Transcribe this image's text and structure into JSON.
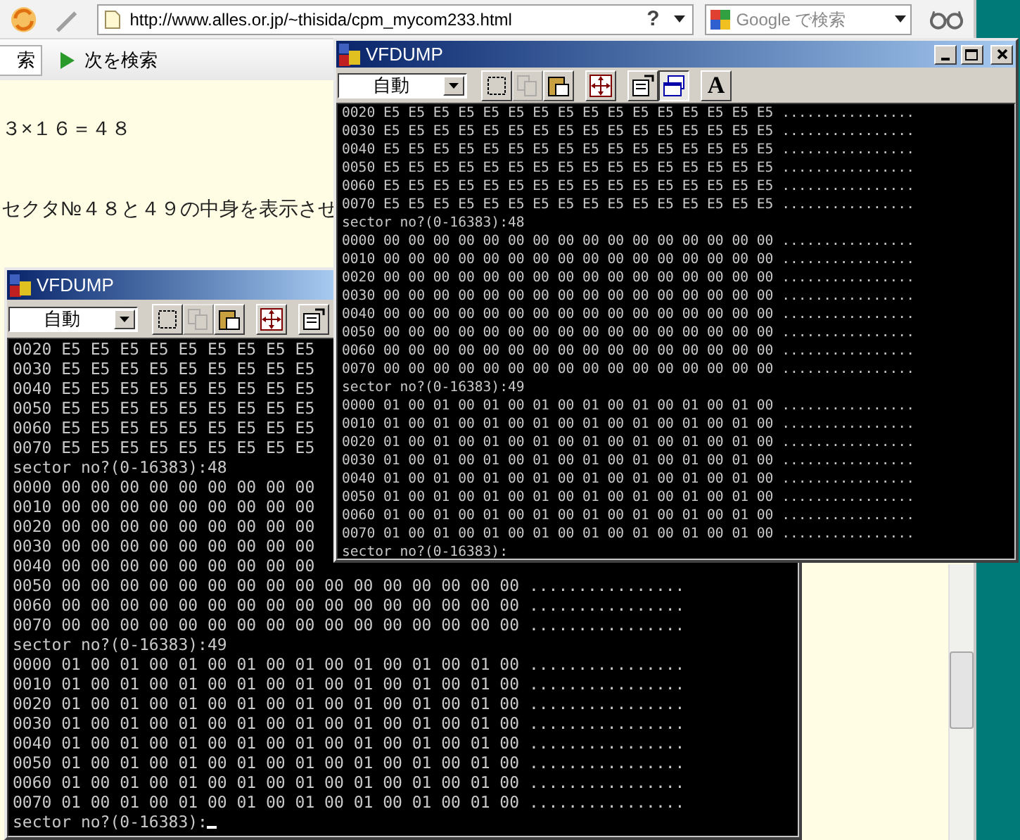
{
  "browser": {
    "address": "http://www.alles.or.jp/~thisida/cpm_mycom233.html",
    "help_button": "?",
    "search": {
      "placeholder": "Google で検索"
    },
    "find_bar": {
      "field_value": "索",
      "next_button": "次を検索"
    }
  },
  "page": {
    "lines": [
      "３×１６＝４８",
      "セクタ№４８と４９の中身を表示させ"
    ]
  },
  "windows": [
    {
      "title": "VFDUMP",
      "mode": "自動",
      "cursor": true,
      "tools": [
        {
          "kind": "select",
          "disabled": false,
          "pressed": false
        },
        {
          "kind": "copy",
          "disabled": true,
          "pressed": false
        },
        {
          "kind": "paste",
          "disabled": false,
          "pressed": false
        },
        {
          "kind": "fullscreen",
          "disabled": false,
          "pressed": false
        },
        {
          "kind": "properties",
          "disabled": false,
          "pressed": false
        }
      ],
      "lines": [
        "0020 E5 E5 E5 E5 E5 E5 E5 E5 E5",
        "0030 E5 E5 E5 E5 E5 E5 E5 E5 E5",
        "0040 E5 E5 E5 E5 E5 E5 E5 E5 E5",
        "0050 E5 E5 E5 E5 E5 E5 E5 E5 E5",
        "0060 E5 E5 E5 E5 E5 E5 E5 E5 E5",
        "0070 E5 E5 E5 E5 E5 E5 E5 E5 E5",
        "sector no?(0-16383):48",
        "0000 00 00 00 00 00 00 00 00 00",
        "0010 00 00 00 00 00 00 00 00 00",
        "0020 00 00 00 00 00 00 00 00 00",
        "0030 00 00 00 00 00 00 00 00 00",
        "0040 00 00 00 00 00 00 00 00 00",
        "0050 00 00 00 00 00 00 00 00 00 00 00 00 00 00 00 00 ................",
        "0060 00 00 00 00 00 00 00 00 00 00 00 00 00 00 00 00 ................",
        "0070 00 00 00 00 00 00 00 00 00 00 00 00 00 00 00 00 ................",
        "sector no?(0-16383):49",
        "0000 01 00 01 00 01 00 01 00 01 00 01 00 01 00 01 00 ................",
        "0010 01 00 01 00 01 00 01 00 01 00 01 00 01 00 01 00 ................",
        "0020 01 00 01 00 01 00 01 00 01 00 01 00 01 00 01 00 ................",
        "0030 01 00 01 00 01 00 01 00 01 00 01 00 01 00 01 00 ................",
        "0040 01 00 01 00 01 00 01 00 01 00 01 00 01 00 01 00 ................",
        "0050 01 00 01 00 01 00 01 00 01 00 01 00 01 00 01 00 ................",
        "0060 01 00 01 00 01 00 01 00 01 00 01 00 01 00 01 00 ................",
        "0070 01 00 01 00 01 00 01 00 01 00 01 00 01 00 01 00 ................",
        "sector no?(0-16383):"
      ]
    },
    {
      "title": "VFDUMP",
      "mode": "自動",
      "cursor": false,
      "caption_buttons": [
        {
          "kind": "minimize"
        },
        {
          "kind": "maximize"
        },
        {
          "kind": "close"
        }
      ],
      "tools": [
        {
          "kind": "select",
          "disabled": false,
          "pressed": false
        },
        {
          "kind": "copy",
          "disabled": true,
          "pressed": false
        },
        {
          "kind": "paste",
          "disabled": false,
          "pressed": false
        },
        {
          "kind": "fullscreen",
          "disabled": false,
          "pressed": false
        },
        {
          "kind": "properties",
          "disabled": false,
          "pressed": false
        },
        {
          "kind": "background",
          "disabled": false,
          "pressed": true
        },
        {
          "kind": "font",
          "label": "A",
          "disabled": false,
          "pressed": false
        }
      ],
      "lines": [
        "0020 E5 E5 E5 E5 E5 E5 E5 E5 E5 E5 E5 E5 E5 E5 E5 E5 ................",
        "0030 E5 E5 E5 E5 E5 E5 E5 E5 E5 E5 E5 E5 E5 E5 E5 E5 ................",
        "0040 E5 E5 E5 E5 E5 E5 E5 E5 E5 E5 E5 E5 E5 E5 E5 E5 ................",
        "0050 E5 E5 E5 E5 E5 E5 E5 E5 E5 E5 E5 E5 E5 E5 E5 E5 ................",
        "0060 E5 E5 E5 E5 E5 E5 E5 E5 E5 E5 E5 E5 E5 E5 E5 E5 ................",
        "0070 E5 E5 E5 E5 E5 E5 E5 E5 E5 E5 E5 E5 E5 E5 E5 E5 ................",
        "sector no?(0-16383):48",
        "0000 00 00 00 00 00 00 00 00 00 00 00 00 00 00 00 00 ................",
        "0010 00 00 00 00 00 00 00 00 00 00 00 00 00 00 00 00 ................",
        "0020 00 00 00 00 00 00 00 00 00 00 00 00 00 00 00 00 ................",
        "0030 00 00 00 00 00 00 00 00 00 00 00 00 00 00 00 00 ................",
        "0040 00 00 00 00 00 00 00 00 00 00 00 00 00 00 00 00 ................",
        "0050 00 00 00 00 00 00 00 00 00 00 00 00 00 00 00 00 ................",
        "0060 00 00 00 00 00 00 00 00 00 00 00 00 00 00 00 00 ................",
        "0070 00 00 00 00 00 00 00 00 00 00 00 00 00 00 00 00 ................",
        "sector no?(0-16383):49",
        "0000 01 00 01 00 01 00 01 00 01 00 01 00 01 00 01 00 ................",
        "0010 01 00 01 00 01 00 01 00 01 00 01 00 01 00 01 00 ................",
        "0020 01 00 01 00 01 00 01 00 01 00 01 00 01 00 01 00 ................",
        "0030 01 00 01 00 01 00 01 00 01 00 01 00 01 00 01 00 ................",
        "0040 01 00 01 00 01 00 01 00 01 00 01 00 01 00 01 00 ................",
        "0050 01 00 01 00 01 00 01 00 01 00 01 00 01 00 01 00 ................",
        "0060 01 00 01 00 01 00 01 00 01 00 01 00 01 00 01 00 ................",
        "0070 01 00 01 00 01 00 01 00 01 00 01 00 01 00 01 00 ................",
        "sector no?(0-16383):"
      ]
    }
  ]
}
